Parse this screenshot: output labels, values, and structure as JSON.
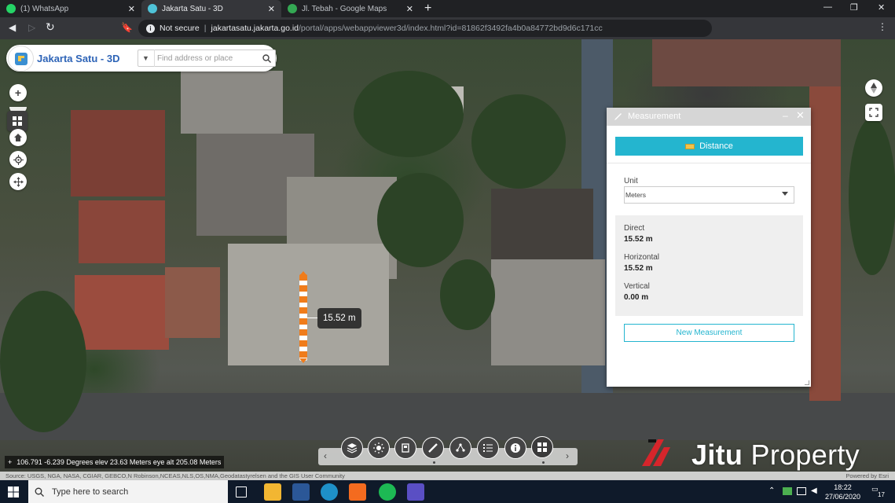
{
  "browser": {
    "tabs": [
      {
        "title": "(1) WhatsApp",
        "favicon": "whatsapp-icon",
        "color": "#25d366"
      },
      {
        "title": "Jakarta Satu - 3D",
        "favicon": "jakarta-satu-icon",
        "color": "#4fc3d8"
      },
      {
        "title": "Jl. Tebah - Google Maps",
        "favicon": "google-maps-icon",
        "color": "#34a853"
      }
    ],
    "security_label": "Not secure",
    "url_host": "jakartasatu.jakarta.go.id",
    "url_path": "/portal/apps/webappviewer3d/index.html?id=81862f3492fa4b0a84772bd9d6c171cc"
  },
  "app": {
    "title": "Jakarta Satu - 3D",
    "search_placeholder": "Find address or place"
  },
  "map": {
    "measurement_label": "15.52 m",
    "coords_readout": "106.791 -6.239 Degrees  elev 23.63 Meters  eye alt 205.08 Meters",
    "attribution": "Source: USGS, NGA, NASA, CGIAR, GEBCO,N Robinson,NCEAS,NLS,OS,NMA,Geodatastyrelsen and the GIS User Community",
    "powered_by": "Powered by Esri",
    "measure_color": "#f07c1b"
  },
  "measurement_panel": {
    "title": "Measurement",
    "tool_label": "Distance",
    "unit_label": "Unit",
    "unit_value": "Meters",
    "direct_label": "Direct",
    "direct_value": "15.52 m",
    "horizontal_label": "Horizontal",
    "horizontal_value": "15.52 m",
    "vertical_label": "Vertical",
    "vertical_value": "0.00 m",
    "new_button": "New Measurement",
    "accent": "#24b5cf"
  },
  "watermark": {
    "bold": "Jitu",
    "rest": "Property"
  },
  "taskbar": {
    "search_placeholder": "Type here to search",
    "time": "18:22",
    "date": "27/06/2020",
    "notification_count": "17"
  }
}
